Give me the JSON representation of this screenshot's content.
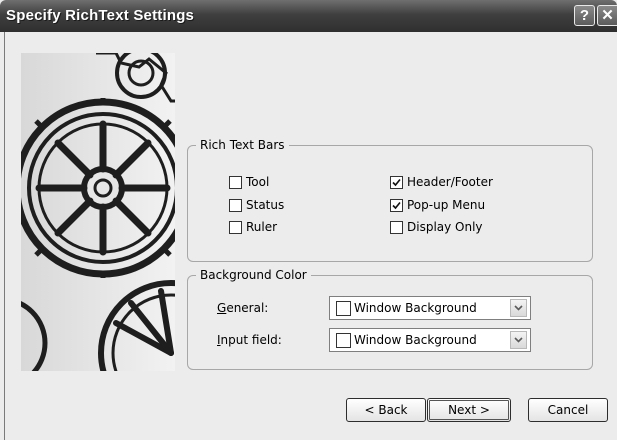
{
  "window": {
    "title": "Specify RichText Settings",
    "help_label": "?",
    "close_label": "✕"
  },
  "rich_text_bars": {
    "legend": "Rich Text Bars",
    "options": [
      {
        "label": "Tool",
        "checked": false
      },
      {
        "label": "Status",
        "checked": false
      },
      {
        "label": "Ruler",
        "checked": false
      },
      {
        "label": "Header/Footer",
        "checked": true
      },
      {
        "label": "Pop-up Menu",
        "checked": true
      },
      {
        "label": "Display Only",
        "checked": false
      }
    ]
  },
  "background_color": {
    "legend": "Background Color",
    "general_label": "General:",
    "general_mnemonic": "G",
    "general_rest": "eneral:",
    "general_value": "Window Background",
    "input_label": "Input field:",
    "input_mnemonic": "I",
    "input_rest": "nput field:",
    "input_value": "Window Background"
  },
  "buttons": {
    "back": "< Back",
    "next": "Next >",
    "cancel": "Cancel"
  }
}
